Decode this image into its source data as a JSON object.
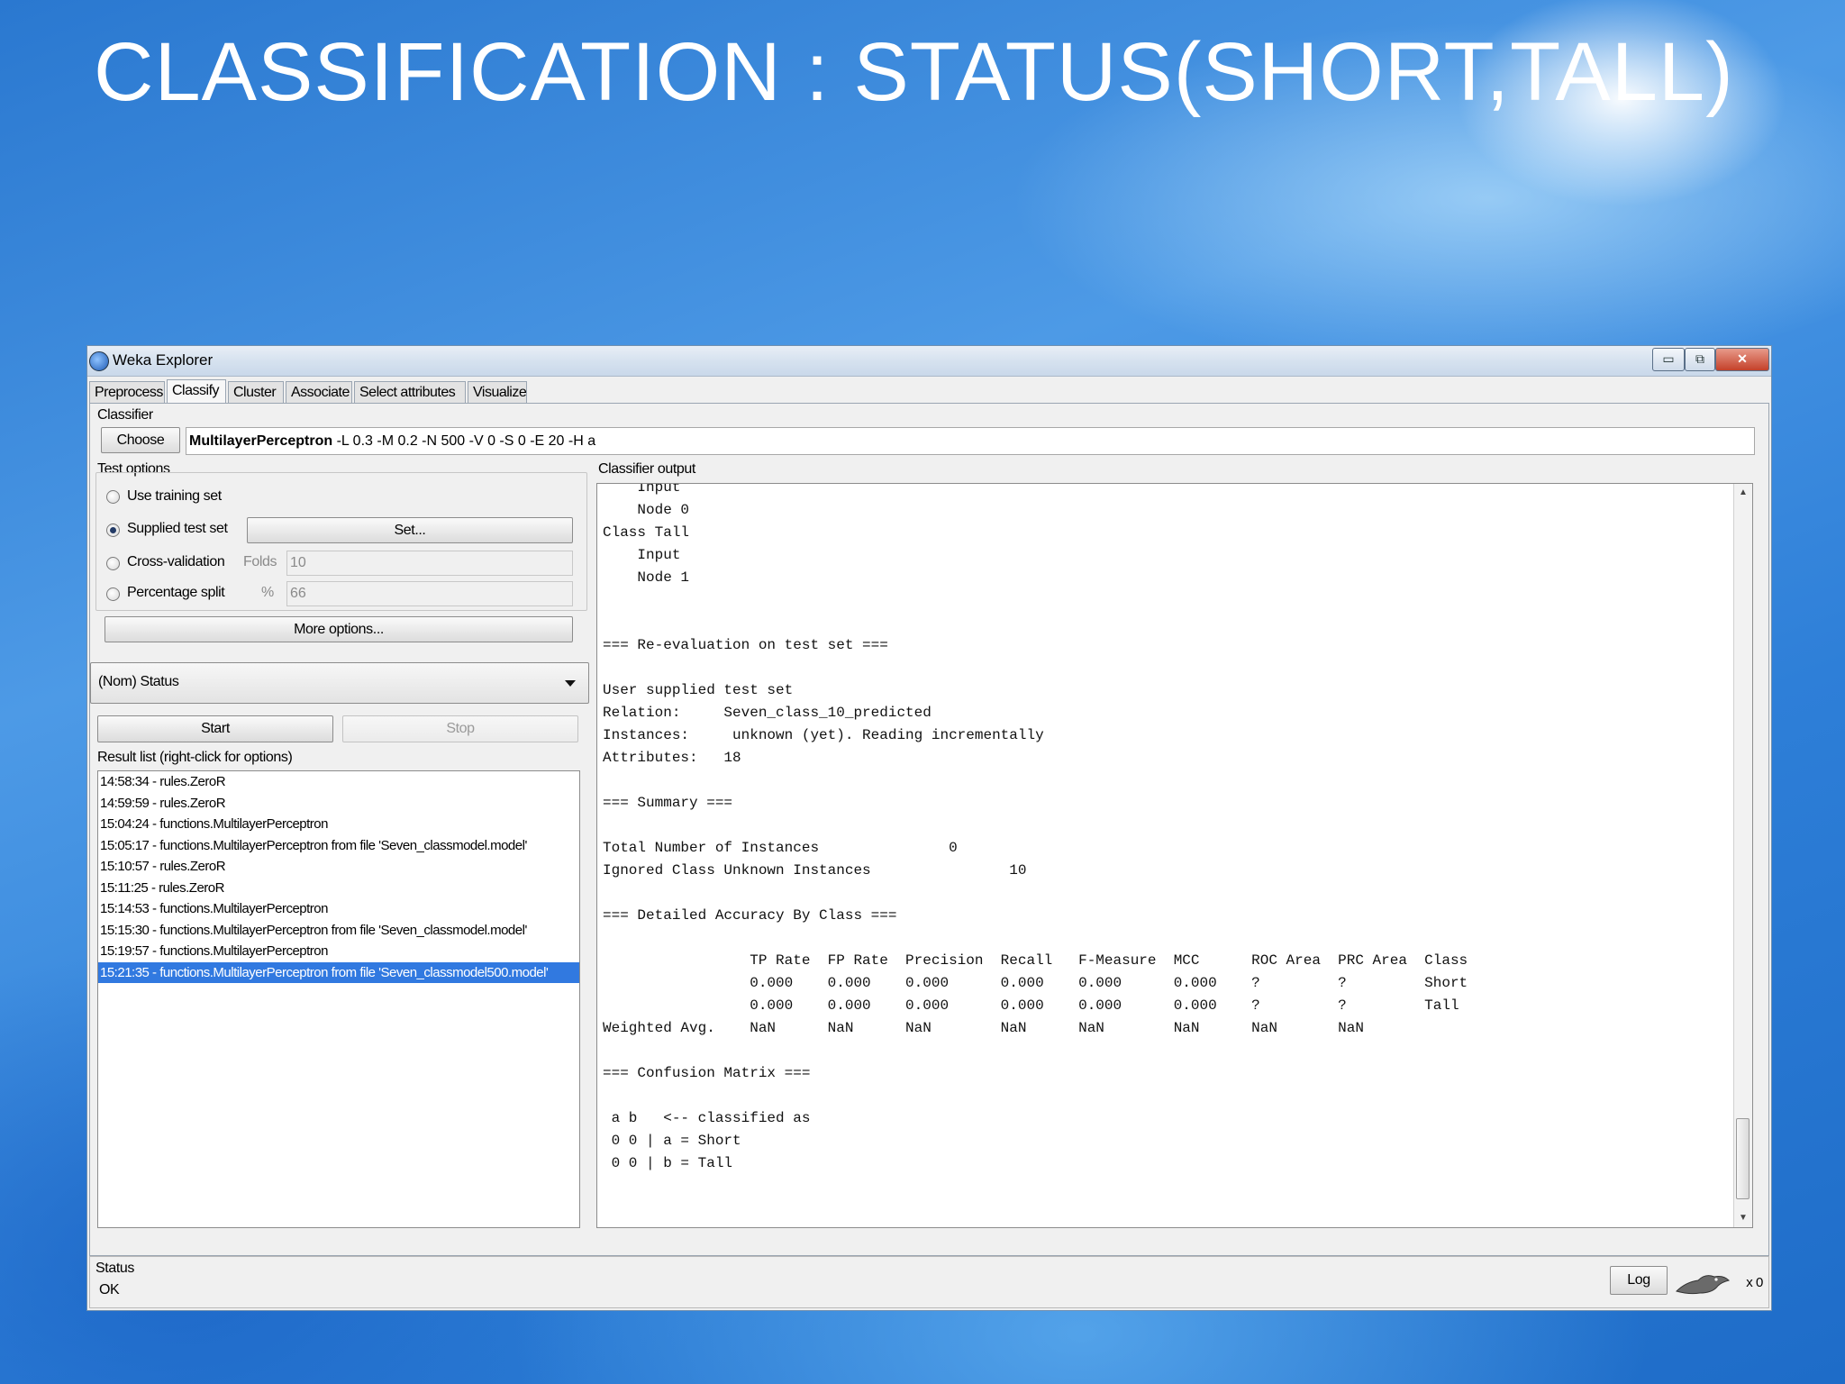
{
  "slide": {
    "title": "CLASSIFICATION : STATUS(SHORT,TALL)"
  },
  "window": {
    "title": "Weka Explorer",
    "controls": {
      "minimize": "▭",
      "restore": "⧉",
      "close": "✕"
    }
  },
  "tabs": [
    "Preprocess",
    "Classify",
    "Cluster",
    "Associate",
    "Select attributes",
    "Visualize"
  ],
  "classifier": {
    "section_label": "Classifier",
    "choose_label": "Choose",
    "name": "MultilayerPerceptron",
    "options": " -L 0.3 -M 0.2 -N 500 -V 0 -S 0 -E 20 -H a"
  },
  "test_options": {
    "section_label": "Test options",
    "use_training": "Use training set",
    "supplied_test": "Supplied test set",
    "set_button": "Set...",
    "cross_validation": "Cross-validation",
    "folds_label": "Folds",
    "folds_value": "10",
    "percentage_split": "Percentage split",
    "percent_label": "%",
    "percent_value": "66",
    "more_options": "More options..."
  },
  "class_attribute": {
    "selected": "(Nom) Status"
  },
  "actions": {
    "start": "Start",
    "stop": "Stop"
  },
  "result_list": {
    "label": "Result list (right-click for options)",
    "items": [
      "14:58:34 - rules.ZeroR",
      "14:59:59 - rules.ZeroR",
      "15:04:24 - functions.MultilayerPerceptron",
      "15:05:17 - functions.MultilayerPerceptron from file 'Seven_classmodel.model'",
      "15:10:57 - rules.ZeroR",
      "15:11:25 - rules.ZeroR",
      "15:14:53 - functions.MultilayerPerceptron",
      "15:15:30 - functions.MultilayerPerceptron from file 'Seven_classmodel.model'",
      "15:19:57 - functions.MultilayerPerceptron",
      "15:21:35 - functions.MultilayerPerceptron from file 'Seven_classmodel500.model'"
    ]
  },
  "classifier_output": {
    "label": "Classifier output",
    "text": "    Input\n    Node 0\nClass Tall\n    Input\n    Node 1\n\n\n=== Re-evaluation on test set ===\n\nUser supplied test set\nRelation:     Seven_class_10_predicted\nInstances:     unknown (yet). Reading incrementally\nAttributes:   18\n\n=== Summary ===\n\nTotal Number of Instances               0\nIgnored Class Unknown Instances                10\n\n=== Detailed Accuracy By Class ===\n\n                 TP Rate  FP Rate  Precision  Recall   F-Measure  MCC      ROC Area  PRC Area  Class\n                 0.000    0.000    0.000      0.000    0.000      0.000    ?         ?         Short\n                 0.000    0.000    0.000      0.000    0.000      0.000    ?         ?         Tall\nWeighted Avg.    NaN      NaN      NaN        NaN      NaN        NaN      NaN       NaN\n\n=== Confusion Matrix ===\n\n a b   <-- classified as\n 0 0 | a = Short\n 0 0 | b = Tall"
  },
  "status": {
    "label": "Status",
    "value": "OK",
    "log_button": "Log",
    "count": "x 0"
  }
}
